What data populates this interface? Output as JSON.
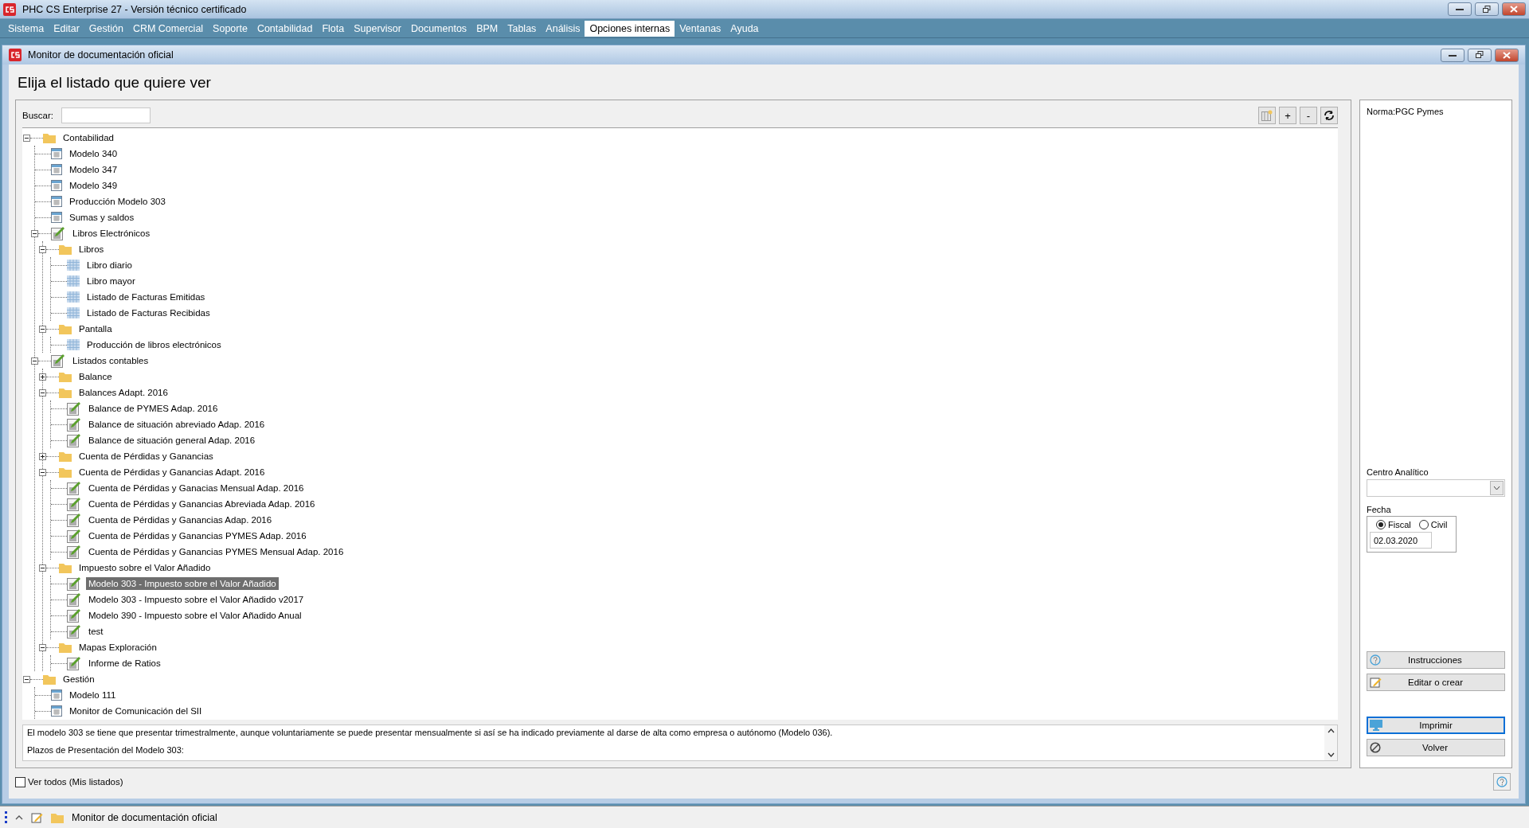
{
  "app_window": {
    "title": "PHC CS Enterprise 27 - Versión técnico certificado"
  },
  "menu": [
    {
      "label": "Sistema",
      "selected": false
    },
    {
      "label": "Editar",
      "selected": false
    },
    {
      "label": "Gestión",
      "selected": false
    },
    {
      "label": "CRM Comercial",
      "selected": false
    },
    {
      "label": "Soporte",
      "selected": false
    },
    {
      "label": "Contabilidad",
      "selected": false
    },
    {
      "label": "Flota",
      "selected": false
    },
    {
      "label": "Supervisor",
      "selected": false
    },
    {
      "label": "Documentos",
      "selected": false
    },
    {
      "label": "BPM",
      "selected": false
    },
    {
      "label": "Tablas",
      "selected": false
    },
    {
      "label": "Análisis",
      "selected": false
    },
    {
      "label": "Opciones internas",
      "selected": true
    },
    {
      "label": "Ventanas",
      "selected": false
    },
    {
      "label": "Ayuda",
      "selected": false
    }
  ],
  "window": {
    "title": "Monitor de documentación oficial",
    "heading": "Elija el listado que quiere ver"
  },
  "search": {
    "label": "Buscar:"
  },
  "toolbar": [
    {
      "kind": "columns"
    },
    {
      "kind": "text",
      "label": "+"
    },
    {
      "kind": "text",
      "label": "-"
    },
    {
      "kind": "refresh"
    }
  ],
  "tree": [
    {
      "label": "Contabilidad",
      "kind": "folder",
      "expanded": true,
      "selected": false,
      "children": [
        {
          "label": "Modelo 340",
          "kind": "form",
          "selected": false
        },
        {
          "label": "Modelo 347",
          "kind": "form",
          "selected": false
        },
        {
          "label": "Modelo 349",
          "kind": "form",
          "selected": false
        },
        {
          "label": "Producción Modelo 303",
          "kind": "form",
          "selected": false
        },
        {
          "label": "Sumas y saldos",
          "kind": "form",
          "selected": false
        },
        {
          "label": "Libros Electrónicos",
          "kind": "report",
          "expanded": true,
          "selected": false,
          "children": [
            {
              "label": "Libros",
              "kind": "folder",
              "expanded": true,
              "selected": false,
              "children": [
                {
                  "label": "Libro diario",
                  "kind": "grid",
                  "selected": false
                },
                {
                  "label": "Libro mayor",
                  "kind": "grid",
                  "selected": false
                },
                {
                  "label": "Listado de Facturas Emitidas",
                  "kind": "grid",
                  "selected": false
                },
                {
                  "label": "Listado de Facturas Recibidas",
                  "kind": "grid",
                  "selected": false
                }
              ]
            },
            {
              "label": "Pantalla",
              "kind": "folder",
              "expanded": true,
              "selected": false,
              "children": [
                {
                  "label": "Producción de libros electrónicos",
                  "kind": "grid",
                  "selected": false
                }
              ]
            }
          ]
        },
        {
          "label": "Listados contables",
          "kind": "report",
          "expanded": true,
          "selected": false,
          "children": [
            {
              "label": "Balance",
              "kind": "folder",
              "expanded": false,
              "selected": false
            },
            {
              "label": "Balances Adapt. 2016",
              "kind": "folder",
              "expanded": true,
              "selected": false,
              "children": [
                {
                  "label": "Balance de PYMES Adap. 2016",
                  "kind": "report",
                  "selected": false
                },
                {
                  "label": "Balance de situación abreviado Adap. 2016",
                  "kind": "report",
                  "selected": false
                },
                {
                  "label": "Balance de situación general Adap. 2016",
                  "kind": "report",
                  "selected": false
                }
              ]
            },
            {
              "label": "Cuenta de Pérdidas y Ganancias",
              "kind": "folder",
              "expanded": false,
              "selected": false
            },
            {
              "label": "Cuenta de Pérdidas y Ganancias Adapt. 2016",
              "kind": "folder",
              "expanded": true,
              "selected": false,
              "children": [
                {
                  "label": "Cuenta de Pérdidas y Ganacias Mensual Adap. 2016",
                  "kind": "report",
                  "selected": false
                },
                {
                  "label": "Cuenta de Pérdidas y Ganancias Abreviada Adap. 2016",
                  "kind": "report",
                  "selected": false
                },
                {
                  "label": "Cuenta de Pérdidas y Ganancias Adap. 2016",
                  "kind": "report",
                  "selected": false
                },
                {
                  "label": "Cuenta de Pérdidas y Ganancias PYMES Adap. 2016",
                  "kind": "report",
                  "selected": false
                },
                {
                  "label": "Cuenta de Pérdidas y Ganancias PYMES Mensual Adap. 2016",
                  "kind": "report",
                  "selected": false
                }
              ]
            },
            {
              "label": "Impuesto sobre el Valor Añadido",
              "kind": "folder",
              "expanded": true,
              "selected": false,
              "children": [
                {
                  "label": "Modelo 303 - Impuesto sobre el Valor Añadido",
                  "kind": "report",
                  "selected": true
                },
                {
                  "label": "Modelo 303 - Impuesto sobre el Valor Añadido v2017",
                  "kind": "report",
                  "selected": false
                },
                {
                  "label": "Modelo 390 - Impuesto sobre el Valor Añadido Anual",
                  "kind": "report",
                  "selected": false
                },
                {
                  "label": "test",
                  "kind": "report",
                  "selected": false
                }
              ]
            },
            {
              "label": "Mapas Exploración",
              "kind": "folder",
              "expanded": true,
              "selected": false,
              "children": [
                {
                  "label": "Informe de Ratios",
                  "kind": "report",
                  "selected": false
                }
              ]
            }
          ]
        }
      ]
    },
    {
      "label": "Gestión",
      "kind": "folder",
      "expanded": true,
      "selected": false,
      "children": [
        {
          "label": "Modelo 111",
          "kind": "form",
          "selected": false
        },
        {
          "label": "Monitor de Comunicación del SII",
          "kind": "form",
          "selected": false
        }
      ]
    }
  ],
  "description": [
    "El modelo 303 se tiene que presentar trimestralmente, aunque voluntariamente se puede presentar mensualmente si así se ha indicado previamente al darse de alta como empresa o autónomo (Modelo 036).",
    "Plazos de Presentación del Modelo 303:"
  ],
  "show_all": {
    "label": "Ver todos (Mis listados)",
    "checked": false
  },
  "side_panel": {
    "norma": "Norma:PGC Pymes",
    "centro_label": "Centro Analítico",
    "fecha_label": "Fecha",
    "fecha_options": [
      {
        "label": "Fiscal",
        "selected": true
      },
      {
        "label": "Civil",
        "selected": false
      }
    ],
    "fecha_value": "02.03.2020",
    "buttons": [
      {
        "label": "Instrucciones",
        "kind": "help",
        "focused": false
      },
      {
        "label": "Editar o crear",
        "kind": "edit",
        "focused": false
      },
      {
        "label": "Imprimir",
        "kind": "print",
        "focused": true
      },
      {
        "label": "Volver",
        "kind": "back",
        "focused": false
      }
    ]
  },
  "taskbar": {
    "label": "Monitor de documentación oficial"
  }
}
